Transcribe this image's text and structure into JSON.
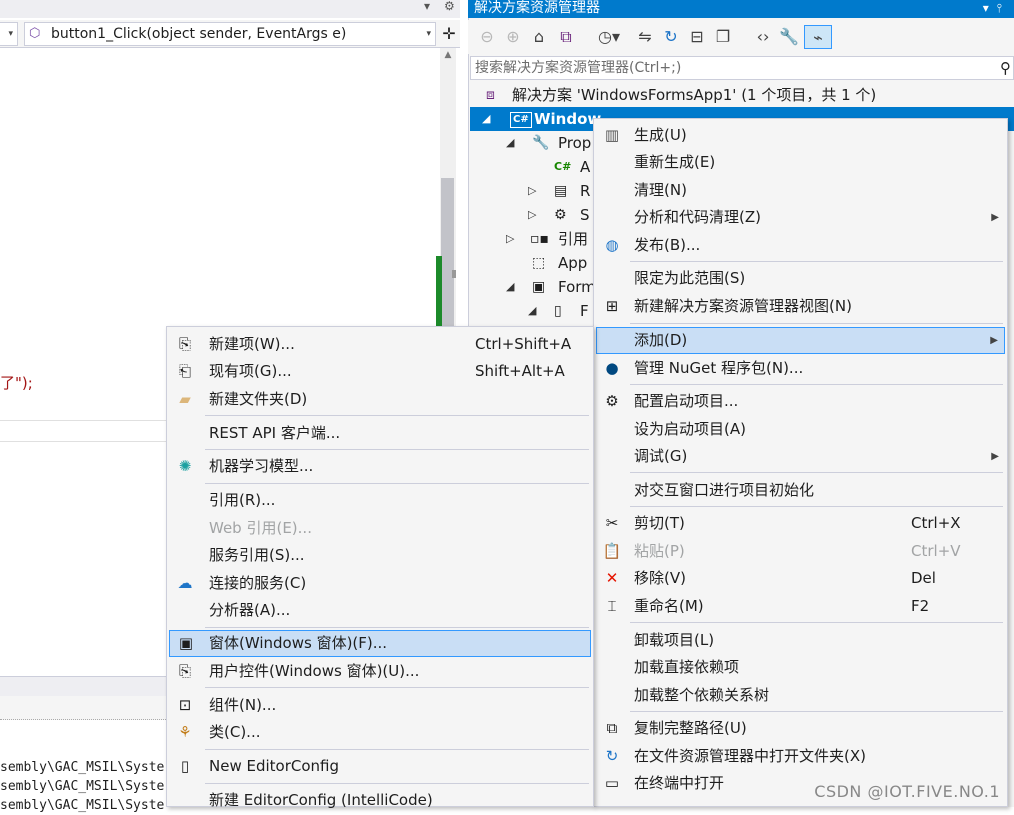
{
  "editor": {
    "method_combo": "button1_Click(object sender, EventArgs e)",
    "code_fragment": "了\");",
    "output_lines": [
      "sembly\\GAC_MSIL\\Syste",
      "sembly\\GAC_MSIL\\Syste",
      "sembly\\GAC_MSIL\\Syste"
    ]
  },
  "solution_explorer": {
    "title": "解决方案资源管理器",
    "search_placeholder": "搜索解决方案资源管理器(Ctrl+;)",
    "tree": [
      {
        "label": "解决方案 'WindowsFormsApp1' (1 个项目，共 1 个)"
      },
      {
        "label": "Window"
      },
      {
        "label": "Prop"
      },
      {
        "label": "A"
      },
      {
        "label": "R"
      },
      {
        "label": "S"
      },
      {
        "label": "引用"
      },
      {
        "label": "App"
      },
      {
        "label": "Form"
      },
      {
        "label": "F"
      }
    ]
  },
  "project_menu": [
    {
      "label": "生成(U)",
      "icon": "build-icon"
    },
    {
      "label": "重新生成(E)"
    },
    {
      "label": "清理(N)"
    },
    {
      "label": "分析和代码清理(Z)",
      "submenu": true
    },
    {
      "label": "发布(B)...",
      "icon": "publish-icon"
    },
    {
      "label": "限定为此范围(S)"
    },
    {
      "label": "新建解决方案资源管理器视图(N)",
      "icon": "new-view-icon"
    },
    {
      "label": "添加(D)",
      "submenu": true,
      "highlighted": true
    },
    {
      "label": "管理 NuGet 程序包(N)...",
      "icon": "nuget-icon"
    },
    {
      "label": "配置启动项目...",
      "icon": "gear-icon"
    },
    {
      "label": "设为启动项目(A)"
    },
    {
      "label": "调试(G)",
      "submenu": true
    },
    {
      "label": "对交互窗口进行项目初始化"
    },
    {
      "label": "剪切(T)",
      "shortcut": "Ctrl+X",
      "icon": "scissors-icon"
    },
    {
      "label": "粘贴(P)",
      "shortcut": "Ctrl+V",
      "icon": "paste-icon",
      "disabled": true
    },
    {
      "label": "移除(V)",
      "shortcut": "Del",
      "icon": "remove-icon"
    },
    {
      "label": "重命名(M)",
      "shortcut": "F2",
      "icon": "rename-icon"
    },
    {
      "label": "卸载项目(L)"
    },
    {
      "label": "加载直接依赖项"
    },
    {
      "label": "加载整个依赖关系树"
    },
    {
      "label": "复制完整路径(U)",
      "icon": "copy-icon"
    },
    {
      "label": "在文件资源管理器中打开文件夹(X)",
      "icon": "open-folder-icon"
    },
    {
      "label": "在终端中打开",
      "icon": "terminal-icon"
    }
  ],
  "add_menu": [
    {
      "label": "新建项(W)...",
      "shortcut": "Ctrl+Shift+A",
      "icon": "new-item-icon"
    },
    {
      "label": "现有项(G)...",
      "shortcut": "Shift+Alt+A",
      "icon": "existing-item-icon"
    },
    {
      "label": "新建文件夹(D)",
      "icon": "new-folder-icon"
    },
    {
      "label": "REST API 客户端..."
    },
    {
      "label": "机器学习模型...",
      "icon": "ml-model-icon"
    },
    {
      "label": "引用(R)..."
    },
    {
      "label": "Web 引用(E)...",
      "disabled": true
    },
    {
      "label": "服务引用(S)..."
    },
    {
      "label": "连接的服务(C)",
      "icon": "connected-service-icon"
    },
    {
      "label": "分析器(A)..."
    },
    {
      "label": "窗体(Windows 窗体)(F)...",
      "icon": "form-icon",
      "highlighted": true
    },
    {
      "label": "用户控件(Windows 窗体)(U)...",
      "icon": "user-control-icon"
    },
    {
      "label": "组件(N)...",
      "icon": "component-icon"
    },
    {
      "label": "类(C)...",
      "icon": "class-icon"
    },
    {
      "label": "New EditorConfig",
      "icon": "editorconfig-icon"
    },
    {
      "label": "新建 EditorConfig (IntelliCode)"
    }
  ],
  "watermark": "CSDN @IOT.FIVE.NO.1"
}
